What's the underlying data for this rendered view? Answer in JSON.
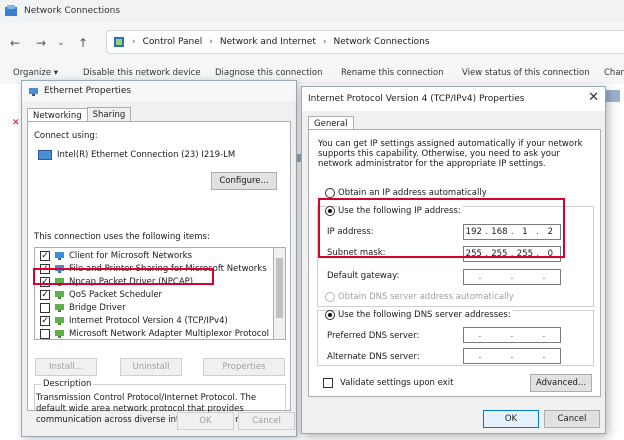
{
  "explorer": {
    "title": "Network Connections",
    "breadcrumb": [
      "Control Panel",
      "Network and Internet",
      "Network Connections"
    ],
    "toolbar": [
      "Organize ▾",
      "Disable this network device",
      "Diagnose this connection",
      "Rename this connection",
      "View status of this connection",
      "Chan"
    ]
  },
  "ethernet_dialog": {
    "title": "Ethernet Properties",
    "tabs": [
      "Networking",
      "Sharing"
    ],
    "connect_using_label": "Connect using:",
    "adapter": "Intel(R) Ethernet Connection (23) I219-LM",
    "configure_label": "Configure...",
    "items_label": "This connection uses the following items:",
    "items": [
      {
        "label": "Client for Microsoft Networks",
        "checked": true
      },
      {
        "label": "File and Printer Sharing for Microsoft Networks",
        "checked": true
      },
      {
        "label": "Npcap Packet Driver (NPCAP)",
        "checked": true
      },
      {
        "label": "QoS Packet Scheduler",
        "checked": true
      },
      {
        "label": "Bridge Driver",
        "checked": false
      },
      {
        "label": "Internet Protocol Version 4 (TCP/IPv4)",
        "checked": true
      },
      {
        "label": "Microsoft Network Adapter Multiplexor Protocol",
        "checked": false
      }
    ],
    "install_label": "Install...",
    "uninstall_label": "Uninstall",
    "properties_label": "Properties",
    "description_title": "Description",
    "description": "Transmission Control Protocol/Internet Protocol. The default wide area network protocol that provides communication across diverse interconnected networks.",
    "ok_label": "OK",
    "cancel_label": "Cancel"
  },
  "ipv4_dialog": {
    "title": "Internet Protocol Version 4 (TCP/IPv4) Properties",
    "tab": "General",
    "intro": "You can get IP settings assigned automatically if your network supports this capability. Otherwise, you need to ask your network administrator for the appropriate IP settings.",
    "obtain_ip_auto": "Obtain an IP address automatically",
    "use_following_ip": "Use the following IP address:",
    "ip_address_label": "IP address:",
    "ip_address": [
      "192",
      "168",
      "1",
      "2"
    ],
    "subnet_mask_label": "Subnet mask:",
    "subnet_mask": [
      "255",
      "255",
      "255",
      "0"
    ],
    "default_gateway_label": "Default gateway:",
    "obtain_dns_auto": "Obtain DNS server address automatically",
    "use_following_dns": "Use the following DNS server addresses:",
    "preferred_dns_label": "Preferred DNS server:",
    "alternate_dns_label": "Alternate DNS server:",
    "validate_label": "Validate settings upon exit",
    "advanced_label": "Advanced...",
    "ok_label": "OK",
    "cancel_label": "Cancel",
    "close_glyph": "✕"
  },
  "colors": {
    "highlight_box": "#d9002b",
    "accent": "#0078d7"
  }
}
